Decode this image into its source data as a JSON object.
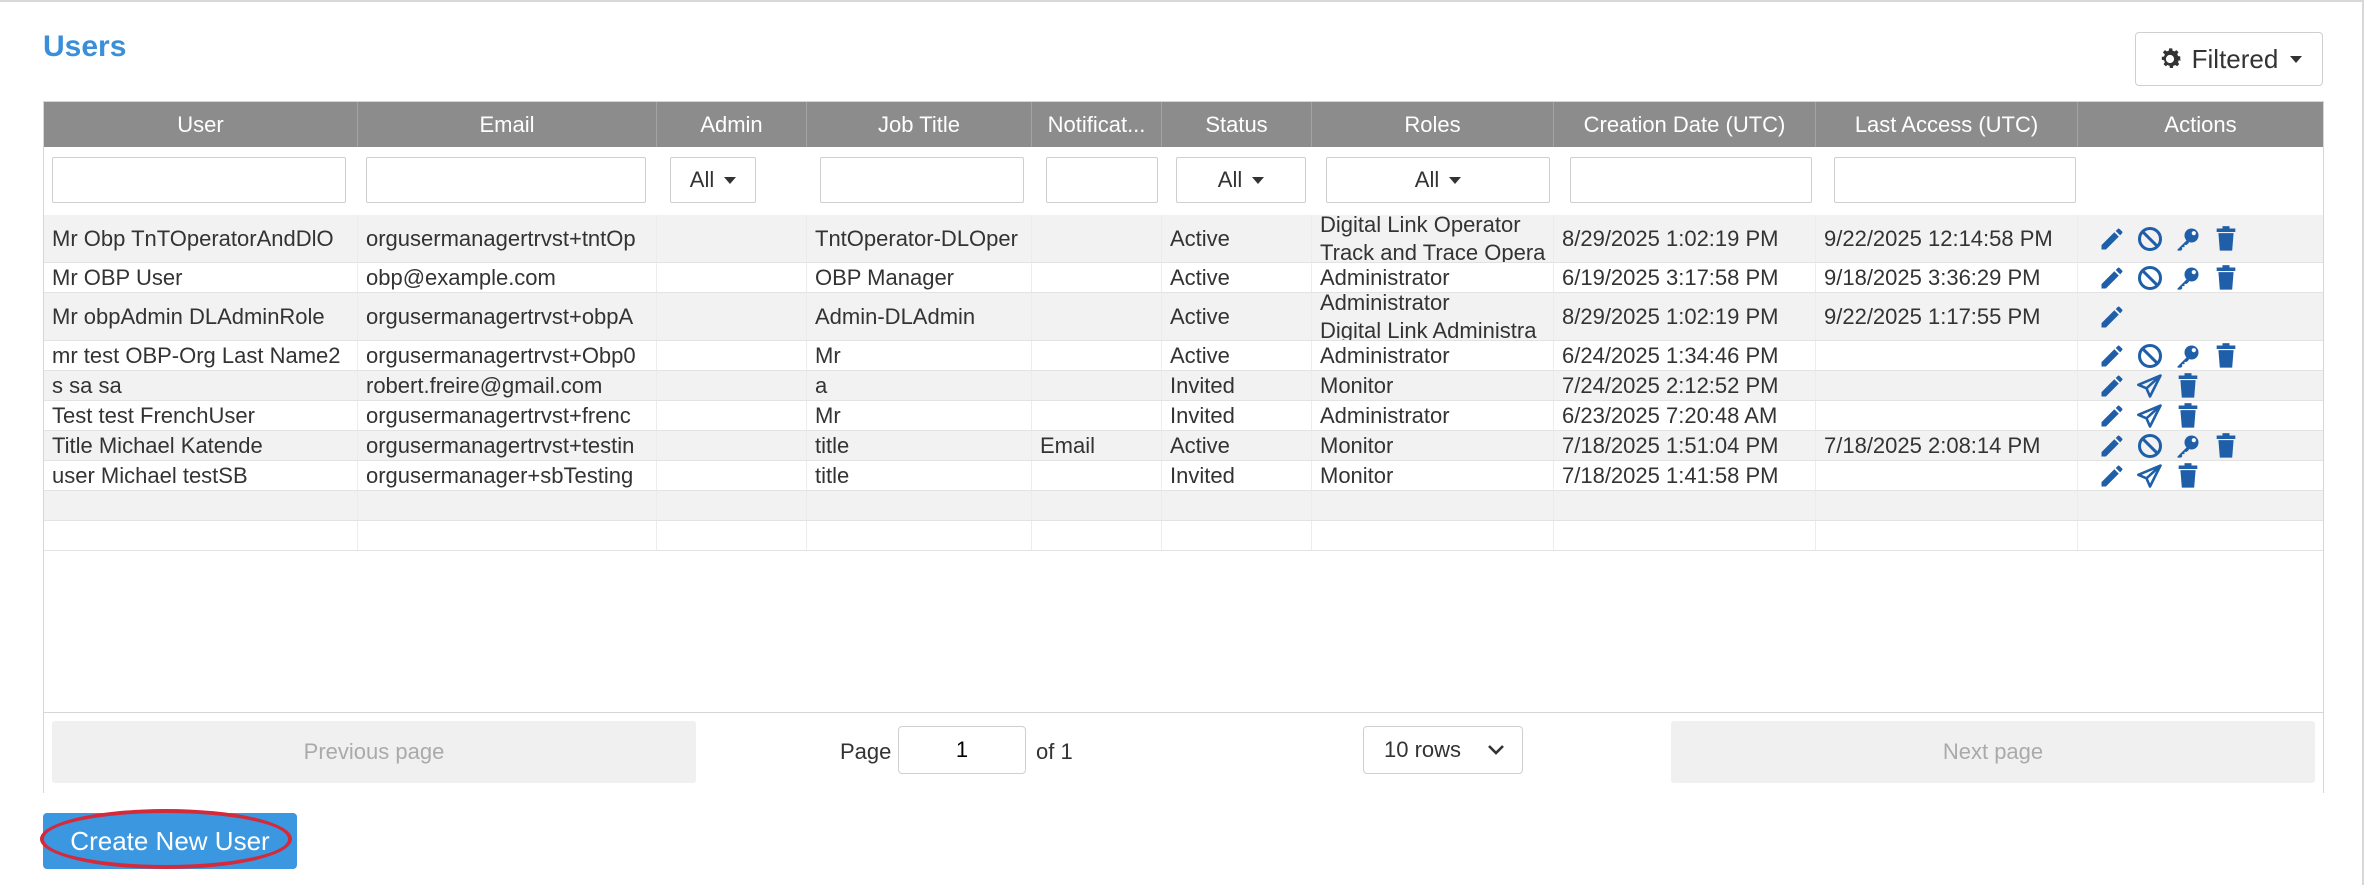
{
  "title": "Users",
  "filter_button": {
    "label": "Filtered"
  },
  "columns": [
    "User",
    "Email",
    "Admin",
    "Job Title",
    "Notificat...",
    "Status",
    "Roles",
    "Creation Date (UTC)",
    "Last Access (UTC)",
    "Actions"
  ],
  "filters": {
    "admin": "All",
    "status": "All",
    "roles": "All"
  },
  "rows": [
    {
      "user": "Mr Obp TnTOperatorAndDlO",
      "email": "orgusermanagertrvst+tntOp",
      "admin": "",
      "job_title": "TntOperator-DLOper",
      "notification": "",
      "status": "Active",
      "roles": [
        "Digital Link Operator",
        "Track and Trace Opera"
      ],
      "created": "8/29/2025 1:02:19 PM",
      "last_access": "9/22/2025 12:14:58 PM",
      "actions": [
        "edit",
        "disable",
        "key",
        "delete"
      ]
    },
    {
      "user": "Mr OBP User",
      "email": "obp@example.com",
      "admin": "",
      "job_title": "OBP Manager",
      "notification": "",
      "status": "Active",
      "roles": [
        "Administrator"
      ],
      "created": "6/19/2025 3:17:58 PM",
      "last_access": "9/18/2025 3:36:29 PM",
      "actions": [
        "edit",
        "disable",
        "key",
        "delete"
      ]
    },
    {
      "user": "Mr obpAdmin DLAdminRole",
      "email": "orgusermanagertrvst+obpA",
      "admin": "",
      "job_title": "Admin-DLAdmin",
      "notification": "",
      "status": "Active",
      "roles": [
        "Administrator",
        "Digital Link Administra"
      ],
      "created": "8/29/2025 1:02:19 PM",
      "last_access": "9/22/2025 1:17:55 PM",
      "actions": [
        "edit"
      ]
    },
    {
      "user": "mr test OBP-Org Last Name2",
      "email": "orgusermanagertrvst+Obp0",
      "admin": "",
      "job_title": "Mr",
      "notification": "",
      "status": "Active",
      "roles": [
        "Administrator"
      ],
      "created": "6/24/2025 1:34:46 PM",
      "last_access": "",
      "actions": [
        "edit",
        "disable",
        "key",
        "delete"
      ]
    },
    {
      "user": "s sa sa",
      "email": "robert.freire@gmail.com",
      "admin": "",
      "job_title": "a",
      "notification": "",
      "status": "Invited",
      "roles": [
        "Monitor"
      ],
      "created": "7/24/2025 2:12:52 PM",
      "last_access": "",
      "actions": [
        "edit",
        "resend",
        "delete"
      ]
    },
    {
      "user": "Test test FrenchUser",
      "email": "orgusermanagertrvst+frenc",
      "admin": "",
      "job_title": "Mr",
      "notification": "",
      "status": "Invited",
      "roles": [
        "Administrator"
      ],
      "created": "6/23/2025 7:20:48 AM",
      "last_access": "",
      "actions": [
        "edit",
        "resend",
        "delete"
      ]
    },
    {
      "user": "Title Michael Katende",
      "email": "orgusermanagertrvst+testin",
      "admin": "",
      "job_title": "title",
      "notification": "Email",
      "status": "Active",
      "roles": [
        "Monitor"
      ],
      "created": "7/18/2025 1:51:04 PM",
      "last_access": "7/18/2025 2:08:14 PM",
      "actions": [
        "edit",
        "disable",
        "key",
        "delete"
      ]
    },
    {
      "user": "user Michael testSB",
      "email": "orgusermanager+sbTesting",
      "admin": "",
      "job_title": "title",
      "notification": "",
      "status": "Invited",
      "roles": [
        "Monitor"
      ],
      "created": "7/18/2025 1:41:58 PM",
      "last_access": "",
      "actions": [
        "edit",
        "resend",
        "delete"
      ]
    }
  ],
  "pagination": {
    "previous": "Previous page",
    "page_label": "Page",
    "page_value": "1",
    "of_label": "of 1",
    "rows_label": "10 rows",
    "next": "Next page"
  },
  "create_button": {
    "label": "Create New User"
  },
  "colors": {
    "accent": "#3a8fd8",
    "header_bg": "#8c8c8c",
    "icon": "#1f5ea8",
    "highlight": "#d42a3a"
  }
}
